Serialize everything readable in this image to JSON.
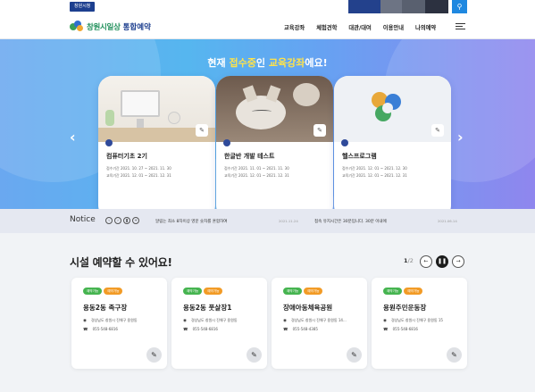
{
  "topbar": {
    "left_label": "창원시청",
    "links": [
      "",
      "",
      "",
      ""
    ]
  },
  "header": {
    "logo_main": "창원시일상",
    "logo_sub": "통합예약",
    "menu": [
      "교육강좌",
      "체험견학",
      "대관/대여",
      "이용안내",
      "나의예약"
    ]
  },
  "banner": {
    "title_pre": "현재",
    "title_hl1": "접수중",
    "title_mid": "인",
    "title_hl2": "교육강좌",
    "title_post": "에요!",
    "cards": [
      {
        "badge": "",
        "title": "컴퓨터기초 2기",
        "meta1": "접수기간 2021. 10. 27 ~ 2021. 11. 30",
        "meta2": "교육기간 2021. 12. 01 ~ 2021. 12. 31"
      },
      {
        "badge": "",
        "title": "한글반 개발 테스트",
        "meta1": "접수기간 2021. 11. 01 ~ 2021. 11. 30",
        "meta2": "교육기간 2021. 12. 01 ~ 2021. 12. 31"
      },
      {
        "badge": "",
        "title": "헬스프로그램",
        "meta1": "접수기간 2021. 12. 01 ~ 2021. 12. 30",
        "meta2": "교육기간 2021. 12. 01 ~ 2021. 12. 31"
      }
    ]
  },
  "notice": {
    "title": "Notice",
    "items": [
      {
        "text": "알림는 최소 8자이상 영문 숫자를 혼합하여",
        "date": "2021.11.24"
      },
      {
        "text": "접속 유지시간은 30분입니다. 30분 이내에",
        "date": "2021.06.14"
      }
    ]
  },
  "facilities": {
    "title": "시설 예약할 수 있어요!",
    "page_current": "1",
    "page_total": "/2",
    "tag_green": "예약가능",
    "tag_orange": "예약가능",
    "cards": [
      {
        "title": "용동2동 족구장",
        "addr": "경상남도 창원시 진해구 용원동",
        "phone": "055-548-6816"
      },
      {
        "title": "용동2동 풋살장1",
        "addr": "경상남도 창원시 진해구 용원동",
        "phone": "055-548-6816"
      },
      {
        "title": "장애아동체육공원",
        "addr": "경상남도 창원시 진해구 용원동 14...",
        "phone": "055-548-4385"
      },
      {
        "title": "용원주민운동장",
        "addr": "경상남도 창원시 진해구 용원동 15",
        "phone": "055-548-6816"
      }
    ]
  },
  "colors": {
    "accent": "#1d3f8f",
    "banner_from": "#6aa8f0",
    "banner_to": "#8f86ee",
    "tag_green": "#46b450",
    "tag_orange": "#f29b26"
  }
}
